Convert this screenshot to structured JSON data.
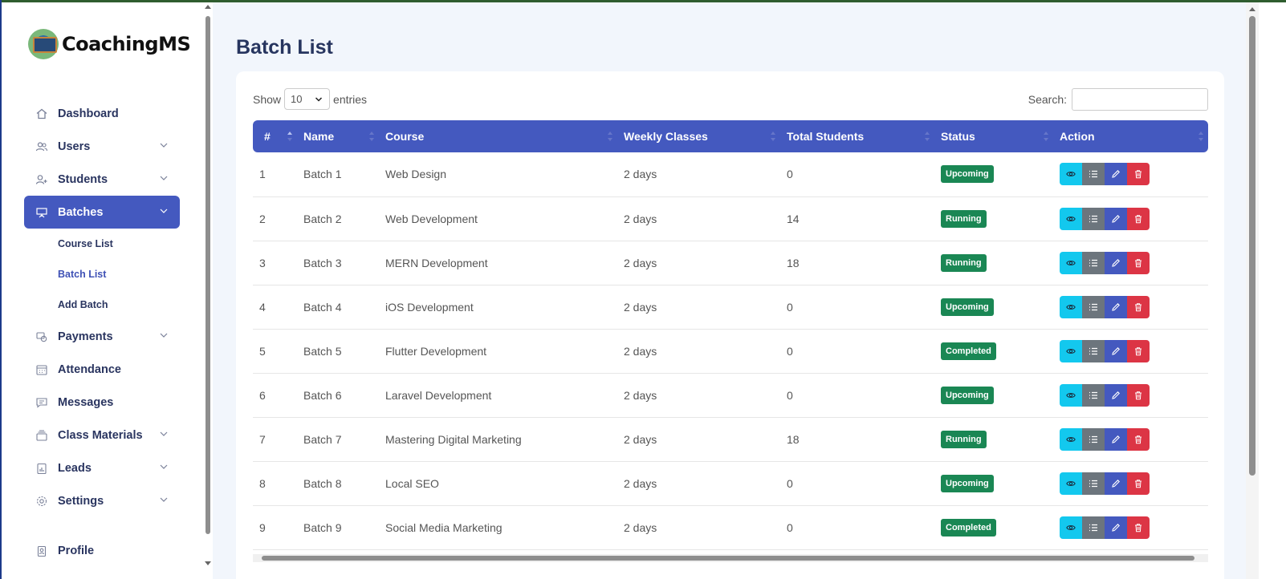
{
  "app": {
    "name": "CoachingMS"
  },
  "sidebar": {
    "items": [
      {
        "label": "Dashboard",
        "icon": "home-icon"
      },
      {
        "label": "Users",
        "icon": "users-icon",
        "has_children": true
      },
      {
        "label": "Students",
        "icon": "user-plus-icon",
        "has_children": true
      },
      {
        "label": "Batches",
        "icon": "presentation-board-icon",
        "has_children": true,
        "active": true,
        "children": [
          {
            "label": "Course List"
          },
          {
            "label": "Batch List",
            "current": true
          },
          {
            "label": "Add Batch"
          }
        ]
      },
      {
        "label": "Payments",
        "icon": "payments-icon",
        "has_children": true
      },
      {
        "label": "Attendance",
        "icon": "calendar-icon"
      },
      {
        "label": "Messages",
        "icon": "chat-icon"
      },
      {
        "label": "Class Materials",
        "icon": "stack-icon",
        "has_children": true
      },
      {
        "label": "Leads",
        "icon": "clipboard-chart-icon",
        "has_children": true
      },
      {
        "label": "Settings",
        "icon": "gear-icon",
        "has_children": true
      },
      {
        "label": "Profile",
        "icon": "id-badge-icon"
      }
    ]
  },
  "page": {
    "title": "Batch List"
  },
  "controls": {
    "show_label": "Show",
    "entries_value": "10",
    "entries_label": "entries",
    "search_label": "Search:",
    "search_value": ""
  },
  "table": {
    "columns": [
      "#",
      "Name",
      "Course",
      "Weekly Classes",
      "Total Students",
      "Status",
      "Action"
    ],
    "rows": [
      {
        "id": "1",
        "name": "Batch 1",
        "course": "Web Design",
        "weekly": "2 days",
        "students": "0",
        "status": "Upcoming"
      },
      {
        "id": "2",
        "name": "Batch 2",
        "course": "Web Development",
        "weekly": "2 days",
        "students": "14",
        "status": "Running"
      },
      {
        "id": "3",
        "name": "Batch 3",
        "course": "MERN Development",
        "weekly": "2 days",
        "students": "18",
        "status": "Running"
      },
      {
        "id": "4",
        "name": "Batch 4",
        "course": "iOS Development",
        "weekly": "2 days",
        "students": "0",
        "status": "Upcoming"
      },
      {
        "id": "5",
        "name": "Batch 5",
        "course": "Flutter Development",
        "weekly": "2 days",
        "students": "0",
        "status": "Completed"
      },
      {
        "id": "6",
        "name": "Batch 6",
        "course": "Laravel Development",
        "weekly": "2 days",
        "students": "0",
        "status": "Upcoming"
      },
      {
        "id": "7",
        "name": "Batch 7",
        "course": "Mastering Digital Marketing",
        "weekly": "2 days",
        "students": "18",
        "status": "Running"
      },
      {
        "id": "8",
        "name": "Batch 8",
        "course": "Local SEO",
        "weekly": "2 days",
        "students": "0",
        "status": "Upcoming"
      },
      {
        "id": "9",
        "name": "Batch 9",
        "course": "Social Media Marketing",
        "weekly": "2 days",
        "students": "0",
        "status": "Completed"
      }
    ],
    "actions": [
      "eye-icon",
      "list-icon",
      "pencil-icon",
      "trash-icon"
    ]
  },
  "colors": {
    "accent": "#4459bf",
    "status_badge": "#1a8754",
    "view_button": "#13c8ee",
    "list_button": "#6c757d",
    "edit_button": "#4459bf",
    "delete_button": "#dc3545",
    "title": "#27355f"
  }
}
